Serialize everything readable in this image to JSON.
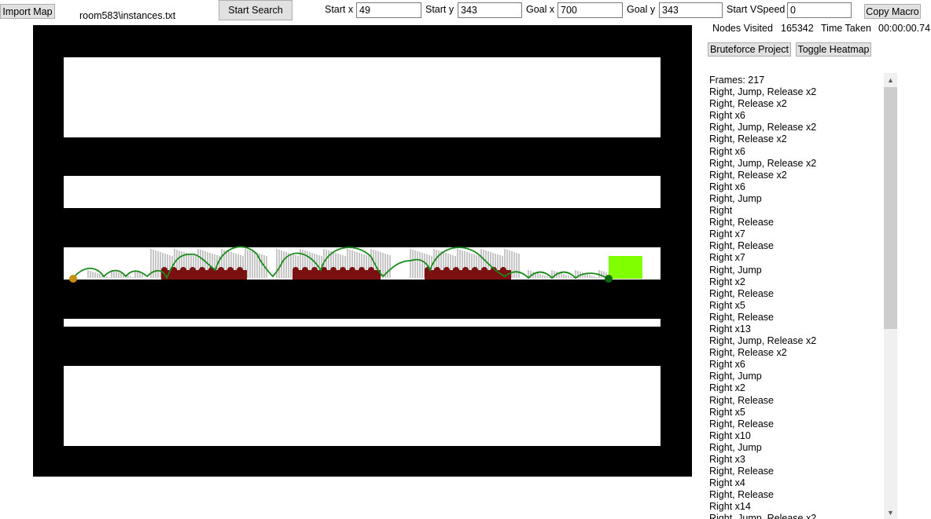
{
  "toolbar": {
    "import_label": "Import Map",
    "file_path": "room583\\instances.txt",
    "start_search_label": "Start Search",
    "start_x_label": "Start x",
    "start_x_value": "49",
    "start_y_label": "Start y",
    "start_y_value": "343",
    "goal_x_label": "Goal x",
    "goal_x_value": "700",
    "goal_y_label": "Goal y",
    "goal_y_value": "343",
    "start_vspeed_label": "Start VSpeed",
    "start_vspeed_value": "0",
    "copy_macro_label": "Copy Macro"
  },
  "stats": {
    "nodes_label": "Nodes Visited",
    "nodes_value": "165342",
    "time_label": "Time Taken",
    "time_value": "00:00:00.74"
  },
  "actions": {
    "bruteforce_label": "Bruteforce Project",
    "heatmap_label": "Toggle Heatmap"
  },
  "macro_list": [
    "Frames: 217",
    "Right, Jump, Release x2",
    "Right, Release x2",
    "Right x6",
    "Right, Jump, Release x2",
    "Right, Release x2",
    "Right x6",
    "Right, Jump, Release x2",
    "Right, Release x2",
    "Right x6",
    "Right, Jump",
    "Right",
    "Right, Release",
    "Right x7",
    "Right, Release",
    "Right x7",
    "Right, Jump",
    "Right x2",
    "Right, Release",
    "Right x5",
    "Right, Release",
    "Right x13",
    "Right, Jump, Release x2",
    "Right, Release x2",
    "Right x6",
    "Right, Jump",
    "Right x2",
    "Right, Release",
    "Right x5",
    "Right, Release",
    "Right x10",
    "Right, Jump",
    "Right x3",
    "Right, Release",
    "Right x4",
    "Right, Release",
    "Right x14",
    "Right, Jump, Release x2"
  ],
  "colors": {
    "wall": "#000000",
    "path": "#1a8a1a",
    "hazard": "#7a1010",
    "goal": "#7fff00",
    "start_marker": "#c8900a",
    "end_marker": "#0a6a0a"
  }
}
